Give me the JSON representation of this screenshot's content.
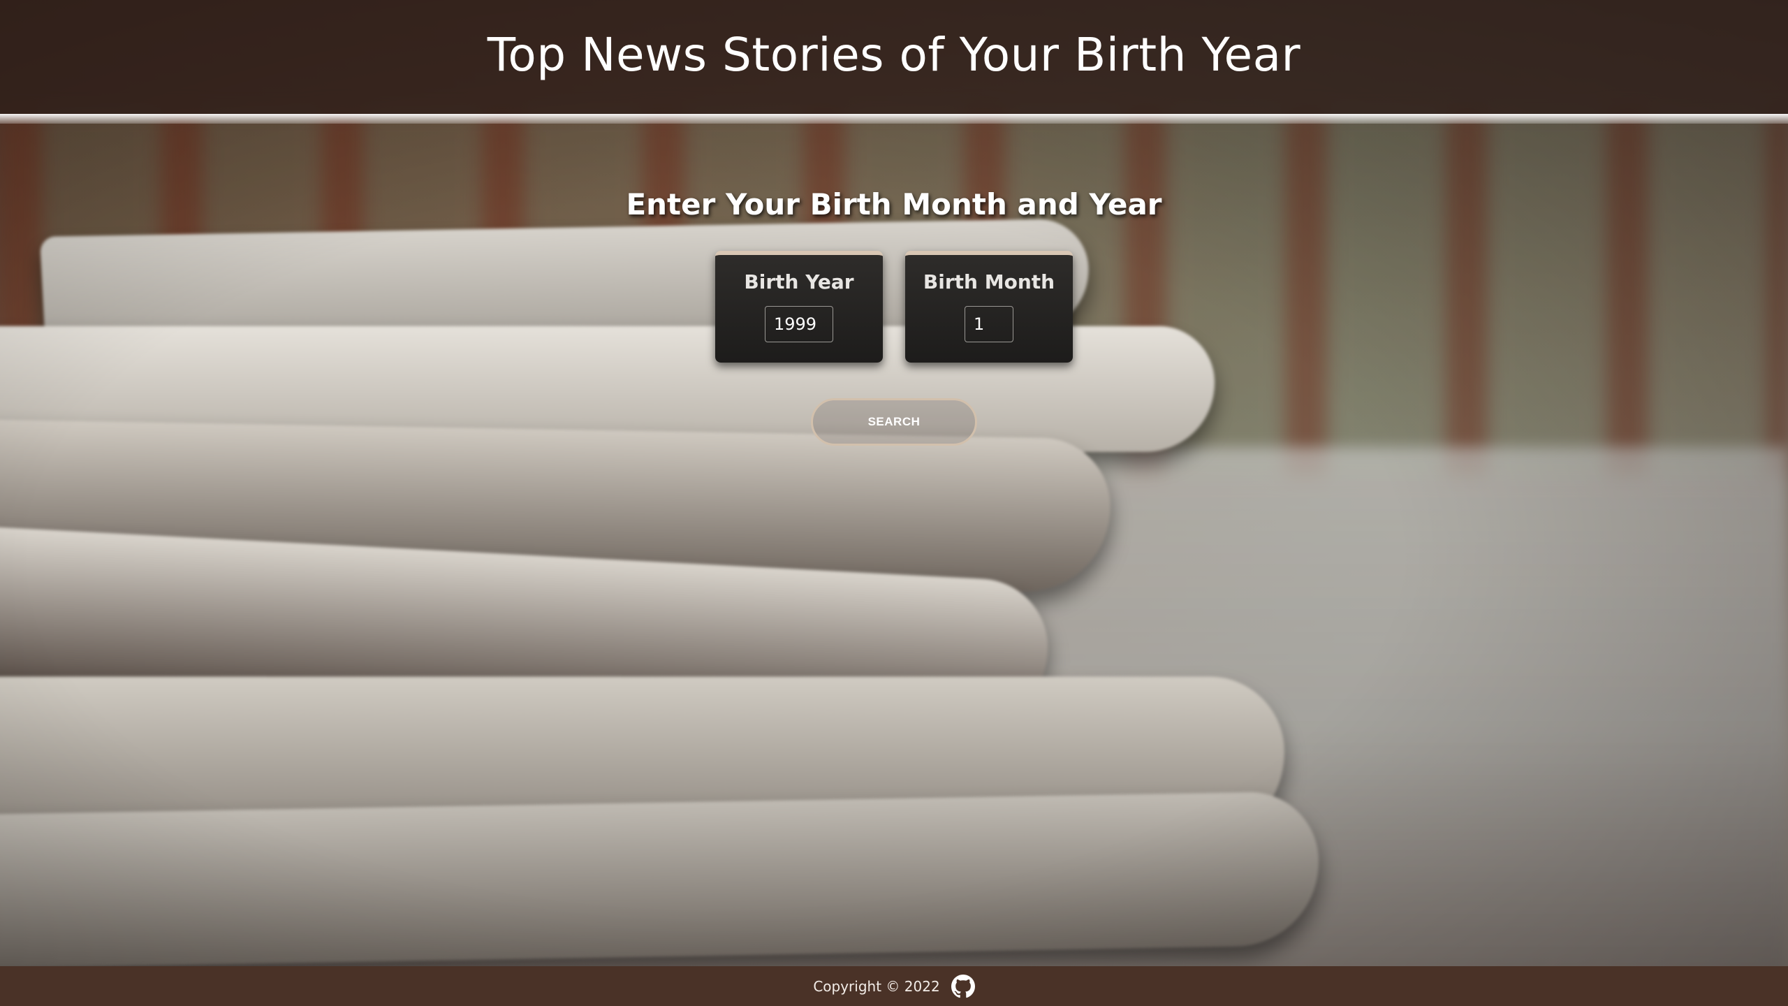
{
  "header": {
    "title": "Top News Stories of Your Birth Year"
  },
  "form": {
    "heading": "Enter Your Birth Month and Year",
    "year": {
      "label": "Birth Year",
      "value": "1999"
    },
    "month": {
      "label": "Birth Month",
      "value": "1"
    },
    "search_label": "SEARCH"
  },
  "footer": {
    "copyright": "Copyright © 2022",
    "icon": "github-icon"
  },
  "colors": {
    "header_bg": "#2d1e18",
    "footer_bg": "#4a3227",
    "card_accent": "#d9c7b4",
    "button_border": "#d2c0ac"
  }
}
